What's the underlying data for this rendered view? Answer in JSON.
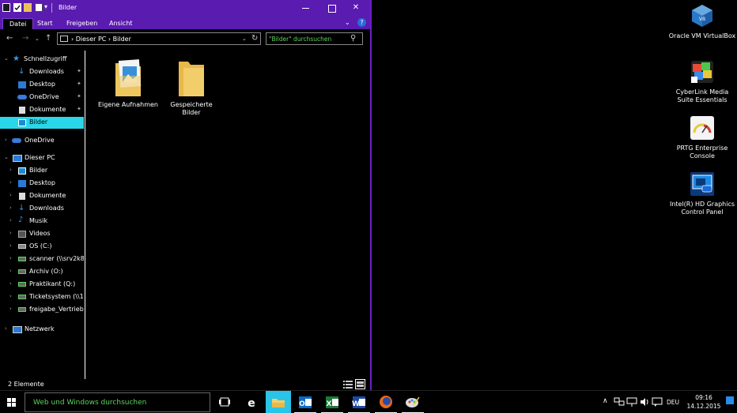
{
  "window": {
    "title": "Bilder",
    "tabs": [
      "Datei",
      "Start",
      "Freigeben",
      "Ansicht"
    ],
    "help": "?",
    "address": {
      "path": "› Dieser PC › Bilder"
    },
    "search": {
      "placeholder": "\"Bilder\" durchsuchen"
    },
    "nav": {
      "quick_access": "Schnellzugriff",
      "quick_items": [
        "Downloads",
        "Desktop",
        "OneDrive",
        "Dokumente",
        "Bilder"
      ],
      "onedrive": "OneDrive",
      "this_pc": "Dieser PC",
      "pc_items": [
        "Bilder",
        "Desktop",
        "Dokumente",
        "Downloads",
        "Musik",
        "Videos",
        "OS (C:)",
        "scanner (\\\\srv2k8de",
        "Archiv (O:)",
        "Praktikant (Q:)",
        "Ticketsystem (\\\\192",
        "freigabe_Vertrieb (\\\\"
      ],
      "network": "Netzwerk"
    },
    "items": [
      {
        "label": "Eigene Aufnahmen"
      },
      {
        "label": "Gespeicherte Bilder"
      }
    ],
    "status": "2 Elemente"
  },
  "desktop_icons": [
    {
      "label": "Oracle VM VirtualBox"
    },
    {
      "label": "CyberLink Media Suite Essentials"
    },
    {
      "label": "PRTG Enterprise Console"
    },
    {
      "label": "Intel(R) HD Graphics Control Panel"
    }
  ],
  "taskbar": {
    "search_text": "Web und Windows durchsuchen",
    "language": "DEU",
    "time": "09:16",
    "date": "14.12.2015"
  },
  "colors": {
    "titlebar": "#5a1bb0",
    "selection": "#29d7e8",
    "search_text": "#5fd25f",
    "folder": "#e8c35c"
  }
}
